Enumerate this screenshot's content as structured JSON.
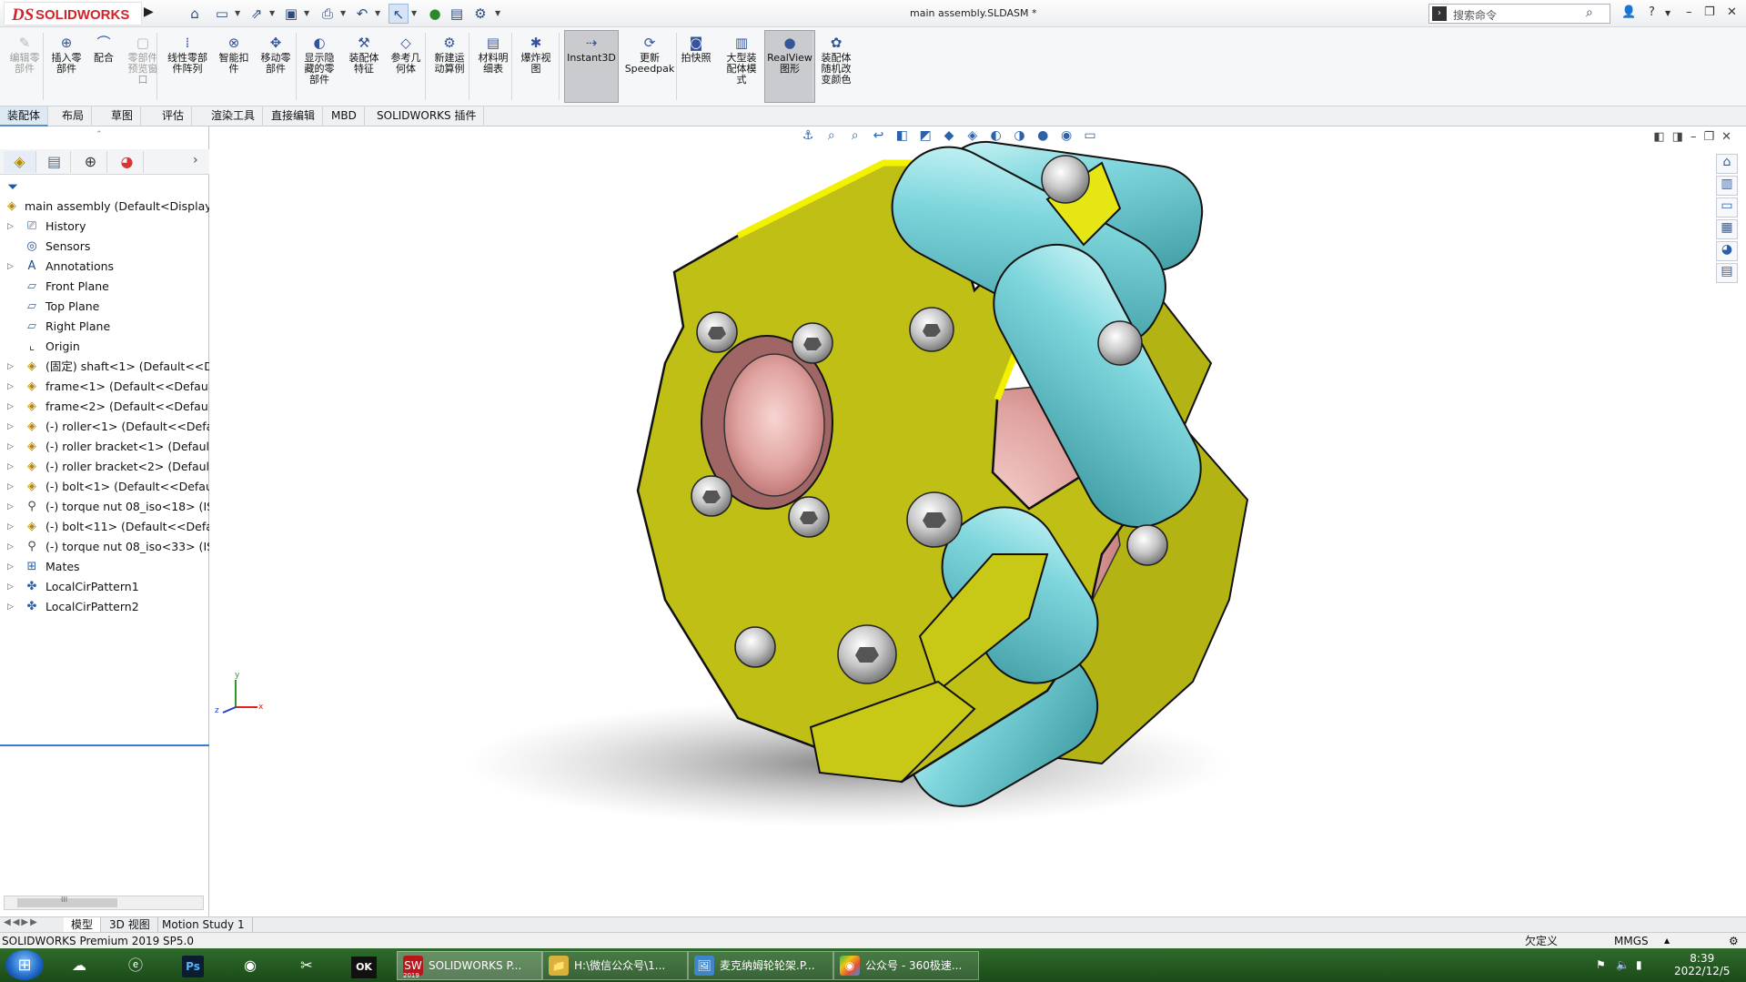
{
  "app": {
    "logo_ds": "DS",
    "logo_text": "SOLIDWORKS",
    "document_title": "main assembly.SLDASM *",
    "search_placeholder": "搜索命令"
  },
  "command_manager": {
    "buttons": [
      {
        "label": "编辑零\n部件",
        "icon": "edit-component-icon",
        "enabled": false
      },
      {
        "label": "插入零\n部件",
        "icon": "insert-component-icon",
        "enabled": true
      },
      {
        "label": "配合",
        "icon": "mate-icon",
        "enabled": true
      },
      {
        "label": "零部件\n预览窗\n口",
        "icon": "component-preview-icon",
        "enabled": false
      },
      {
        "label": "线性零部\n件阵列",
        "icon": "linear-pattern-icon",
        "enabled": true
      },
      {
        "label": "智能扣\n件",
        "icon": "smart-fasteners-icon",
        "enabled": true
      },
      {
        "label": "移动零\n部件",
        "icon": "move-component-icon",
        "enabled": true
      },
      {
        "label": "显示隐\n藏的零\n部件",
        "icon": "show-hidden-icon",
        "enabled": true
      },
      {
        "label": "装配体\n特征",
        "icon": "assembly-features-icon",
        "enabled": true
      },
      {
        "label": "参考几\n何体",
        "icon": "reference-geometry-icon",
        "enabled": true
      },
      {
        "label": "新建运\n动算例",
        "icon": "new-motion-study-icon",
        "enabled": true
      },
      {
        "label": "材料明\n细表",
        "icon": "bom-icon",
        "enabled": true
      },
      {
        "label": "爆炸视\n图",
        "icon": "exploded-view-icon",
        "enabled": true
      },
      {
        "label": "Instant3D",
        "icon": "instant3d-icon",
        "enabled": true,
        "active": true
      },
      {
        "label": "更新\nSpeedpak",
        "icon": "speedpak-icon",
        "enabled": true
      },
      {
        "label": "拍快照",
        "icon": "snapshot-icon",
        "enabled": true
      },
      {
        "label": "大型装\n配体模\n式",
        "icon": "large-assembly-icon",
        "enabled": true
      },
      {
        "label": "RealView\n图形",
        "icon": "realview-icon",
        "enabled": true,
        "active": true
      },
      {
        "label": "装配体\n随机改\n变颜色",
        "icon": "random-color-icon",
        "enabled": true
      }
    ],
    "tabs": [
      "装配体",
      "布局",
      "草图",
      "评估",
      "渲染工具",
      "直接编辑",
      "MBD",
      "SOLIDWORKS 插件"
    ],
    "active_tab": "装配体"
  },
  "feature_tree": {
    "collapse_handle": "⌃",
    "root": "main assembly  (Default<Display S",
    "items": [
      {
        "label": "History",
        "icon": "history-icon",
        "expandable": true
      },
      {
        "label": "Sensors",
        "icon": "sensors-icon",
        "expandable": false
      },
      {
        "label": "Annotations",
        "icon": "annotations-icon",
        "expandable": true
      },
      {
        "label": "Front Plane",
        "icon": "plane-icon",
        "expandable": false
      },
      {
        "label": "Top Plane",
        "icon": "plane-icon",
        "expandable": false
      },
      {
        "label": "Right Plane",
        "icon": "plane-icon",
        "expandable": false
      },
      {
        "label": "Origin",
        "icon": "origin-icon",
        "expandable": false
      },
      {
        "label": "(固定) shaft<1> (Default<<Def",
        "icon": "part-icon",
        "expandable": true
      },
      {
        "label": "frame<1> (Default<<Default>_",
        "icon": "part-icon",
        "expandable": true
      },
      {
        "label": "frame<2> (Default<<Default>_",
        "icon": "part-icon",
        "expandable": true
      },
      {
        "label": "(-) roller<1> (Default<<Defaul",
        "icon": "part-icon",
        "expandable": true
      },
      {
        "label": "(-) roller bracket<1> (Default<",
        "icon": "part-icon",
        "expandable": true
      },
      {
        "label": "(-) roller bracket<2> (Default<",
        "icon": "part-icon",
        "expandable": true
      },
      {
        "label": "(-) bolt<1> (Default<<Default:",
        "icon": "part-icon",
        "expandable": true
      },
      {
        "label": "(-) torque nut 08_iso<18> (ISC",
        "icon": "toolbox-part-icon",
        "expandable": true
      },
      {
        "label": "(-) bolt<11> (Default<<Defaul",
        "icon": "part-icon",
        "expandable": true
      },
      {
        "label": "(-) torque nut 08_iso<33> (ISC",
        "icon": "toolbox-part-icon",
        "expandable": true
      },
      {
        "label": "Mates",
        "icon": "mates-icon",
        "expandable": true
      },
      {
        "label": "LocalCirPattern1",
        "icon": "circular-pattern-icon",
        "expandable": true
      },
      {
        "label": "LocalCirPattern2",
        "icon": "circular-pattern-icon",
        "expandable": true
      }
    ],
    "hscroll_grip": "III"
  },
  "triad": {
    "x": "x",
    "y": "y",
    "z": "z"
  },
  "bottom_tabs": [
    "模型",
    "3D 视图",
    "Motion Study 1"
  ],
  "status_bar": {
    "left": "SOLIDWORKS Premium 2019 SP5.0",
    "define_state": "欠定义",
    "units": "MMGS"
  },
  "taskbar": {
    "windows": [
      {
        "label": "SOLIDWORKS P...",
        "icon_text": "SW",
        "icon_sub": "2019"
      },
      {
        "label": "H:\\微信公众号\\1...",
        "icon_text": "📁"
      },
      {
        "label": "麦克纳姆轮轮架.P...",
        "icon_text": "🖼"
      },
      {
        "label": "公众号 - 360极速...",
        "icon_text": "◉"
      }
    ],
    "time": "8:39",
    "date": "2022/12/5"
  },
  "colors": {
    "frame_yellow": "#c4c414",
    "frame_edge": "#f2f200",
    "roller_cyan": "#7fd7dd",
    "hub_pink": "#e8aaa8",
    "accent_blue": "#2c63a8",
    "sw_red": "#d1232a"
  }
}
